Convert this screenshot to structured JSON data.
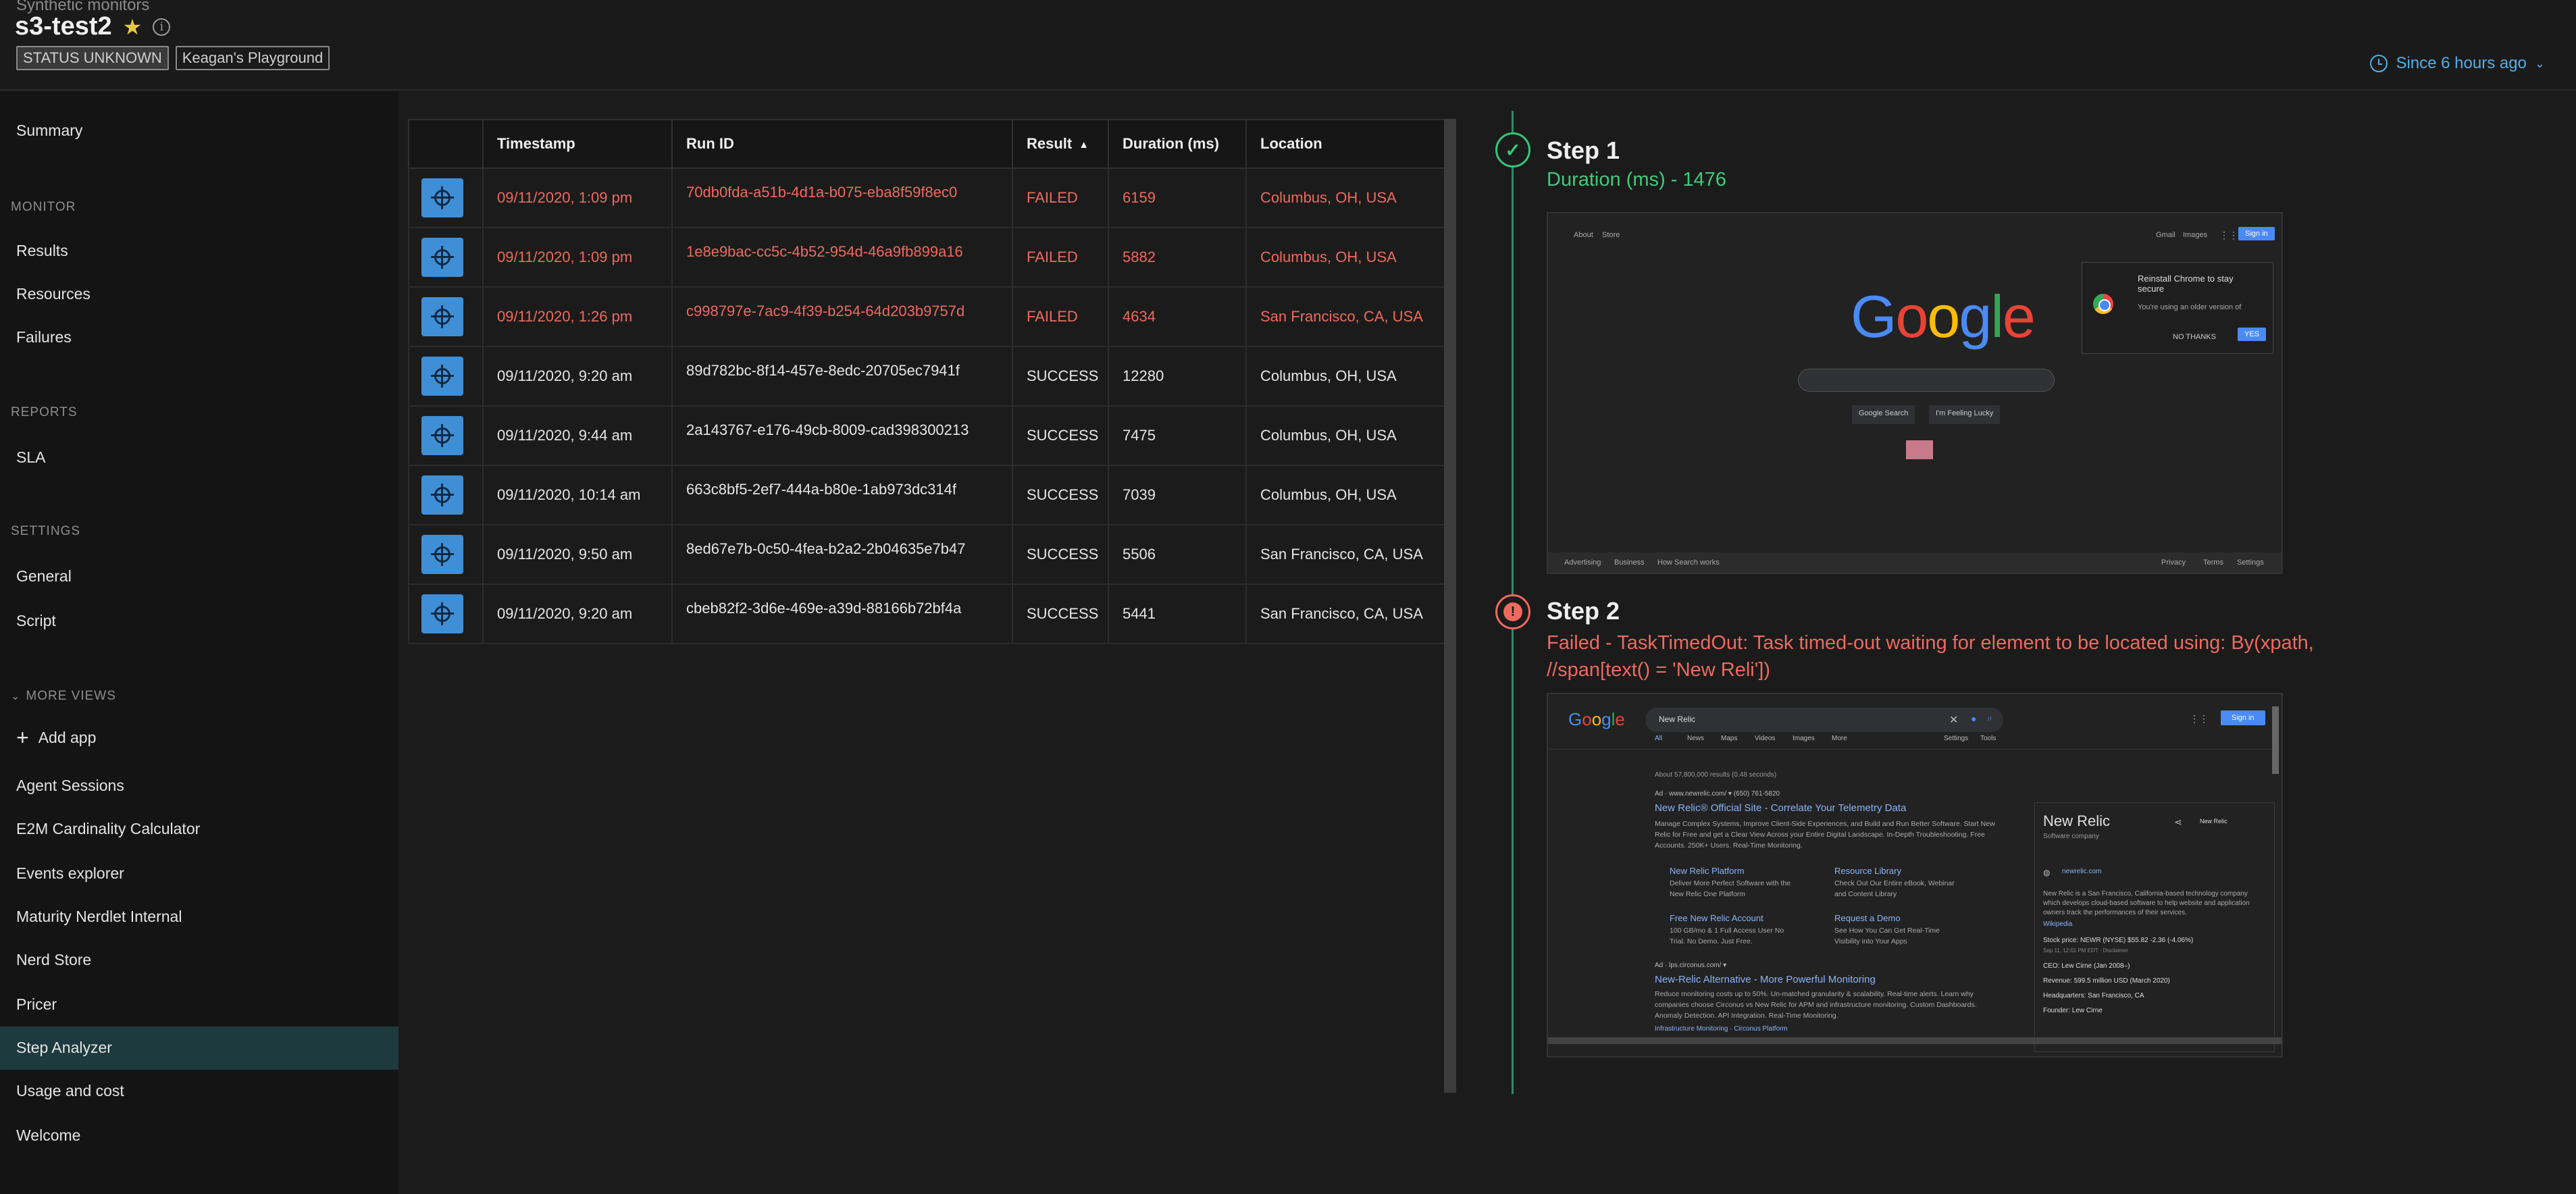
{
  "header": {
    "eyebrow": "Synthetic monitors",
    "entity_name": "s3-test2",
    "tags": [
      "STATUS UNKNOWN",
      "Keagan's Playground"
    ],
    "time_picker": "Since 6 hours ago"
  },
  "sidebar": {
    "summary": "Summary",
    "sections": {
      "monitor": "MONITOR",
      "reports": "REPORTS",
      "settings": "SETTINGS",
      "more_views": "MORE VIEWS"
    },
    "monitor_items": [
      "Results",
      "Resources",
      "Failures"
    ],
    "report_items": [
      "SLA"
    ],
    "settings_items": [
      "General",
      "Script"
    ],
    "add_app": "Add app",
    "more_items": [
      "Agent Sessions",
      "E2M Cardinality Calculator",
      "Events explorer",
      "Maturity Nerdlet Internal",
      "Nerd Store",
      "Pricer",
      "Step Analyzer",
      "Usage and cost",
      "Welcome"
    ],
    "active_item": "Step Analyzer"
  },
  "table": {
    "columns": [
      "Timestamp",
      "Run ID",
      "Result",
      "Duration (ms)",
      "Location"
    ],
    "sort_column": "Result",
    "rows": [
      {
        "timestamp": "09/11/2020, 1:09 pm",
        "run_id": "70db0fda-a51b-4d1a-b075-eba8f59f8ec0",
        "result": "FAILED",
        "duration": "6159",
        "location": "Columbus, OH, USA"
      },
      {
        "timestamp": "09/11/2020, 1:09 pm",
        "run_id": "1e8e9bac-cc5c-4b52-954d-46a9fb899a16",
        "result": "FAILED",
        "duration": "5882",
        "location": "Columbus, OH, USA"
      },
      {
        "timestamp": "09/11/2020, 1:26 pm",
        "run_id": "c998797e-7ac9-4f39-b254-64d203b9757d",
        "result": "FAILED",
        "duration": "4634",
        "location": "San Francisco, CA, USA"
      },
      {
        "timestamp": "09/11/2020, 9:20 am",
        "run_id": "89d782bc-8f14-457e-8edc-20705ec7941f",
        "result": "SUCCESS",
        "duration": "12280",
        "location": "Columbus, OH, USA"
      },
      {
        "timestamp": "09/11/2020, 9:44 am",
        "run_id": "2a143767-e176-49cb-8009-cad398300213",
        "result": "SUCCESS",
        "duration": "7475",
        "location": "Columbus, OH, USA"
      },
      {
        "timestamp": "09/11/2020, 10:14 am",
        "run_id": "663c8bf5-2ef7-444a-b80e-1ab973dc314f",
        "result": "SUCCESS",
        "duration": "7039",
        "location": "Columbus, OH, USA"
      },
      {
        "timestamp": "09/11/2020, 9:50 am",
        "run_id": "8ed67e7b-0c50-4fea-b2a2-2b04635e7b47",
        "result": "SUCCESS",
        "duration": "5506",
        "location": "San Francisco, CA, USA"
      },
      {
        "timestamp": "09/11/2020, 9:20 am",
        "run_id": "cbeb82f2-3d6e-469e-a39d-88166b72bf4a",
        "result": "SUCCESS",
        "duration": "5441",
        "location": "San Francisco, CA, USA"
      }
    ]
  },
  "steps": [
    {
      "title": "Step 1",
      "subtitle": "Duration (ms) - 1476",
      "status": "success"
    },
    {
      "title": "Step 2",
      "subtitle": "Failed - TaskTimedOut: Task timed-out waiting for element to be located using: By(xpath, //span[text() = 'New Reli'])",
      "status": "failed"
    }
  ],
  "screenshot1": {
    "top_left": [
      "About",
      "Store"
    ],
    "top_right": [
      "Gmail",
      "Images"
    ],
    "sign_in": "Sign in",
    "logo": "Google",
    "buttons": [
      "Google Search",
      "I'm Feeling Lucky"
    ],
    "popup_title": "Reinstall Chrome to stay secure",
    "popup_body": "You're using an older version of",
    "popup_no": "NO THANKS",
    "popup_yes": "YES",
    "footer_left": [
      "Advertising",
      "Business",
      "How Search works"
    ],
    "footer_right": [
      "Privacy",
      "Terms",
      "Settings"
    ]
  },
  "screenshot2": {
    "logo": "Google",
    "query": "New Relic",
    "sign_in": "Sign in",
    "tabs": [
      "All",
      "News",
      "Maps",
      "Videos",
      "Images",
      "More",
      "Settings",
      "Tools"
    ],
    "result_count": "About 57,800,000 results (0.48 seconds)",
    "ad1_url": "Ad · www.newrelic.com/ ▾   (650) 761-5820",
    "ad1_title": "New Relic® Official Site - Correlate Your Telemetry Data",
    "ad1_desc": "Manage Complex Systems, Improve Client-Side Experiences, and Build and Run Better Software. Start New Relic for Free and get a Clear View Across your Entire Digital Landscape. In-Depth Troubleshooting. Free Accounts. 250K+ Users. Real-Time Monitoring.",
    "sitelinks": [
      {
        "title": "New Relic Platform",
        "desc": "Deliver More Perfect Software with the New Relic One Platform"
      },
      {
        "title": "Resource Library",
        "desc": "Check Out Our Entire eBook, Webinar and Content Library"
      },
      {
        "title": "Free New Relic Account",
        "desc": "100 GB/mo & 1 Full Access User No Trial. No Demo. Just Free."
      },
      {
        "title": "Request a Demo",
        "desc": "See How You Can Get Real-Time Visibility into Your Apps"
      }
    ],
    "ad2_url": "Ad · lps.circonus.com/ ▾",
    "ad2_title": "New-Relic Alternative - More Powerful Monitoring",
    "ad2_desc": "Reduce monitoring costs up to 50%. Un-matched granularity & scalability. Real-time alerts. Learn why companies choose Circonus vs New Relic for APM and infrastructure monitoring. Custom Dashboards. Anomaly Detection. API Integration. Real-Time Monitoring.",
    "ad2_links": "Infrastructure Monitoring · Circonus Platform",
    "panel_title": "New Relic",
    "panel_sub": "Software company",
    "panel_site": "newrelic.com",
    "panel_desc": "New Relic is a San Francisco, California-based technology company which develops cloud-based software to help website and application owners track the performances of their services.",
    "panel_wiki": "Wikipedia",
    "panel_stock": "Stock price: NEWR (NYSE)  $55.82  -2.36 (-4.06%)",
    "panel_stock_date": "Sep 11, 12:01 PM EDT · Disclaimer",
    "panel_ceo": "CEO: Lew Cirne (Jan 2008–)",
    "panel_revenue": "Revenue: 599.5 million USD (March 2020)",
    "panel_hq": "Headquarters: San Francisco, CA",
    "panel_founder": "Founder: Lew Cirne",
    "panel_brand": "New Relic"
  }
}
